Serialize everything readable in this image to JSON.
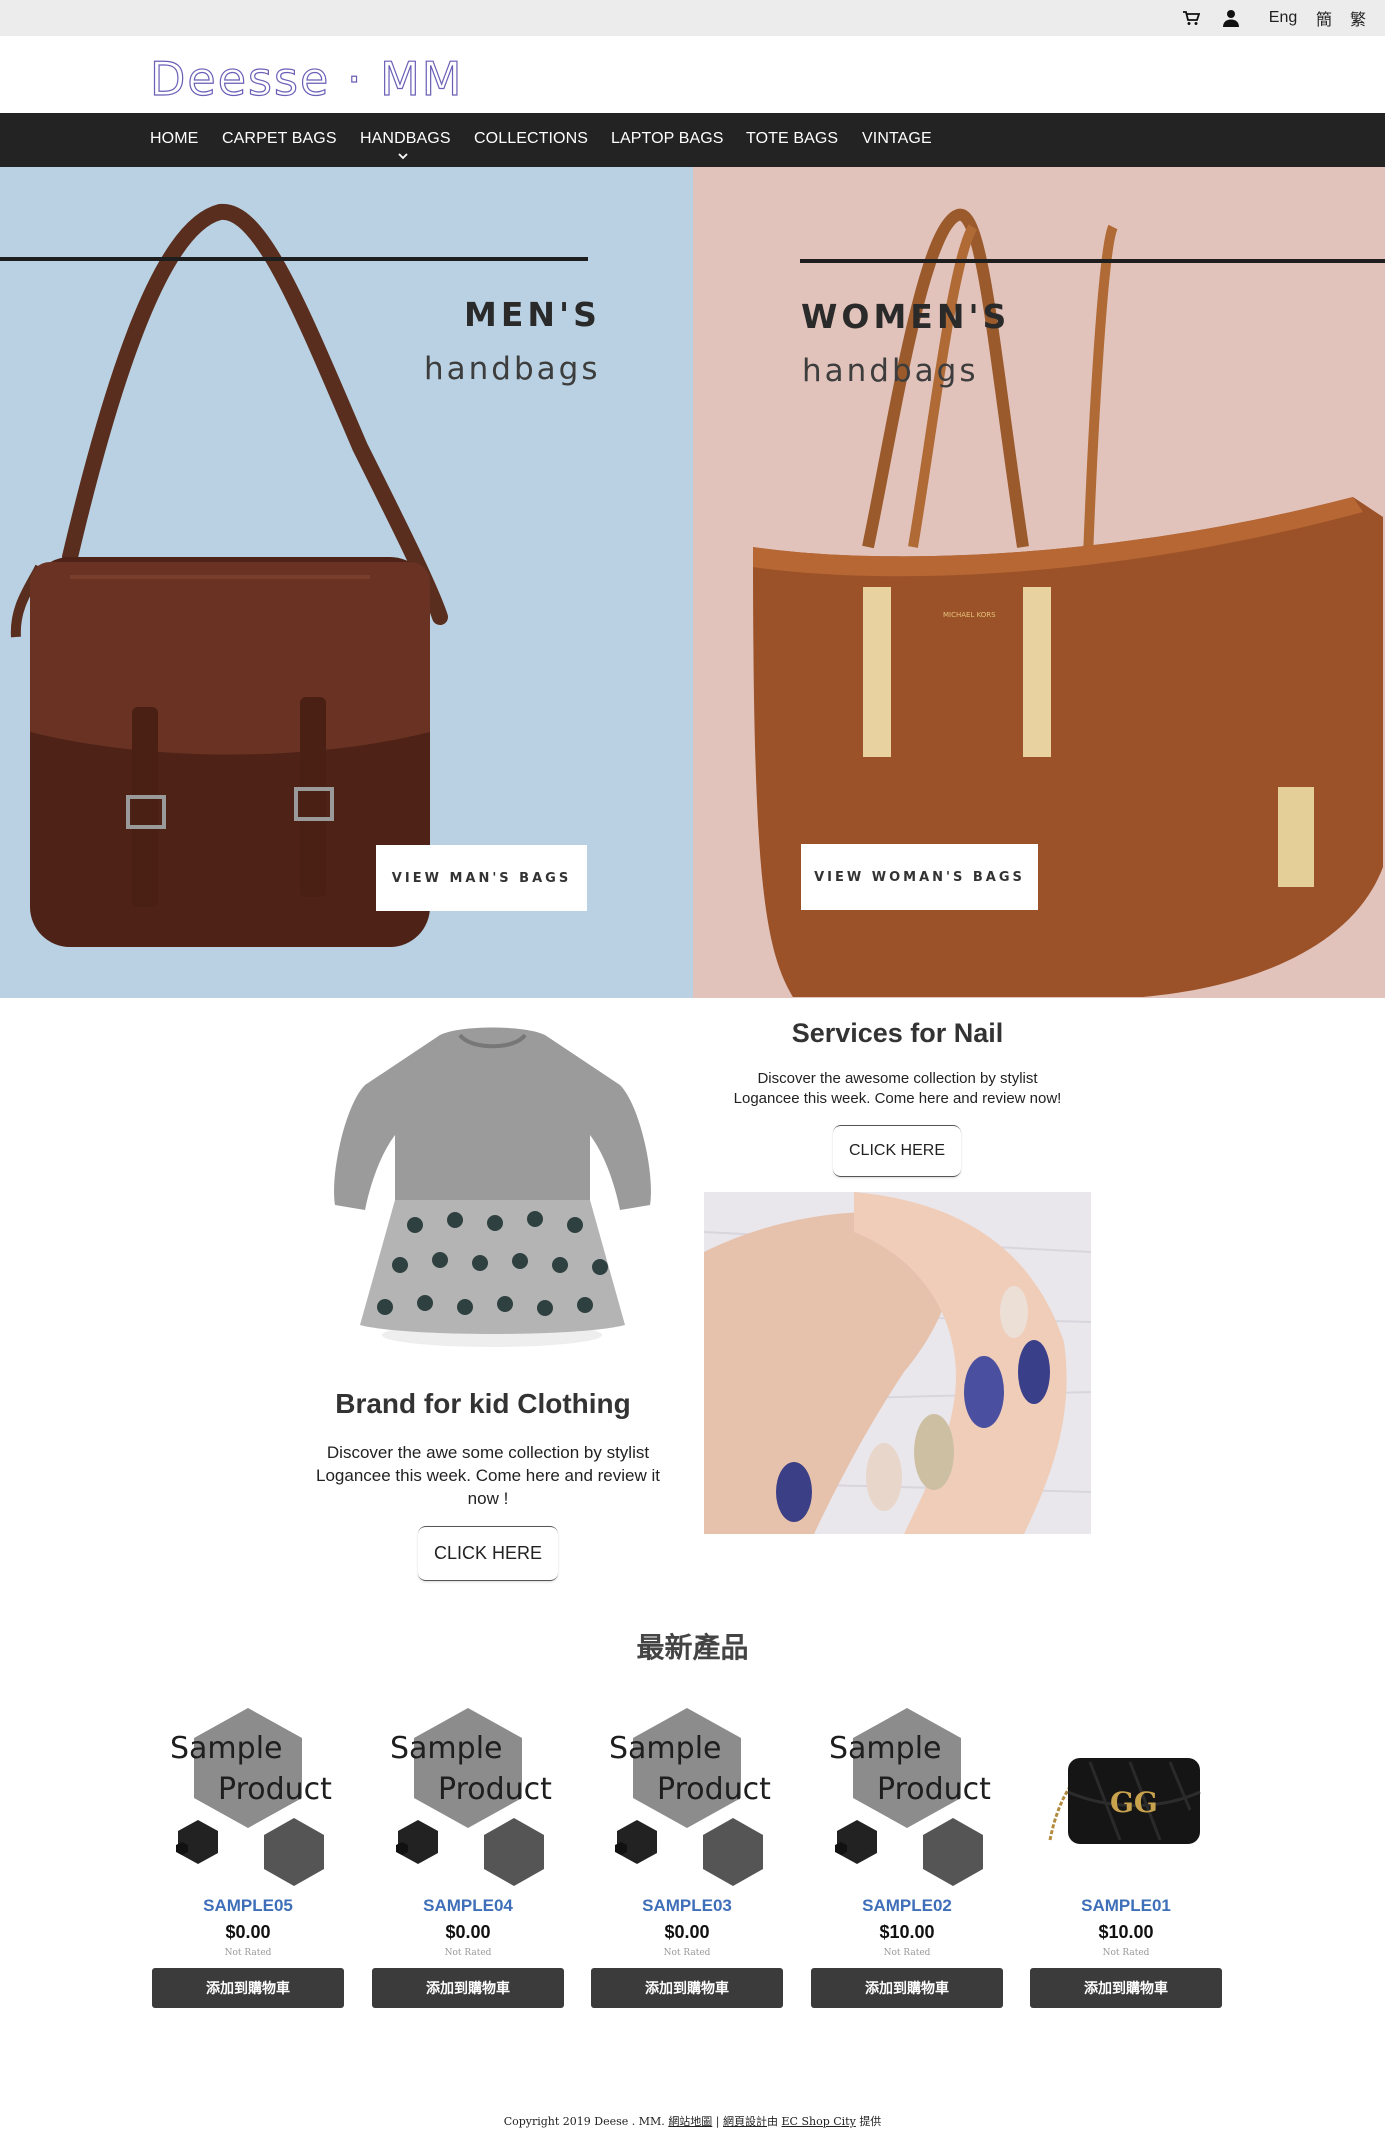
{
  "topbar": {
    "cart_icon": "cart-icon",
    "user_icon": "user-icon",
    "languages": [
      "Eng",
      "簡",
      "繁"
    ]
  },
  "header": {
    "logo_text": "Deesse · MM"
  },
  "nav": {
    "items": [
      "HOME",
      "CARPET BAGS",
      "HANDBAGS",
      "COLLECTIONS",
      "LAPTOP BAGS",
      "TOTE BAGS",
      "VINTAGE"
    ],
    "dropdown_icon": "chevron-down-icon"
  },
  "hero": {
    "men": {
      "title": "MEN'S",
      "subtitle": "handbags",
      "cta": "VIEW MAN'S BAGS",
      "bg_color": "#b9d1e2"
    },
    "women": {
      "title": "WOMEN'S",
      "subtitle": "handbags",
      "cta": "VIEW WOMAN'S BAGS",
      "bg_color": "#e2c3bb"
    }
  },
  "promos": {
    "nail": {
      "title": "Services for Nail",
      "desc": "Discover the awesome collection by stylist Logancee this week. Come here and review now!",
      "cta": "CLICK HERE"
    },
    "kids": {
      "title": "Brand for kid Clothing",
      "desc": "Discover the awe some collection by stylist Logancee this week. Come here and review it now !",
      "cta": "CLICK HERE"
    }
  },
  "products": {
    "heading": "最新產品",
    "placeholder_text": [
      "Sample",
      "Product"
    ],
    "items": [
      {
        "name": "SAMPLE05",
        "price": "$0.00",
        "rating": "Not Rated",
        "button": "添加到購物車"
      },
      {
        "name": "SAMPLE04",
        "price": "$0.00",
        "rating": "Not Rated",
        "button": "添加到購物車"
      },
      {
        "name": "SAMPLE03",
        "price": "$0.00",
        "rating": "Not Rated",
        "button": "添加到購物車"
      },
      {
        "name": "SAMPLE02",
        "price": "$10.00",
        "rating": "Not Rated",
        "button": "添加到購物車"
      },
      {
        "name": "SAMPLE01",
        "price": "$10.00",
        "rating": "Not Rated",
        "button": "添加到購物車"
      }
    ]
  },
  "footer": {
    "copyright": "Copyright 2019 Deese . MM.",
    "sitemap": "網站地圖",
    "sep": " | ",
    "design": "網頁設計",
    "by": "由",
    "provider": "EC Shop City",
    "provided": "提供"
  },
  "colors": {
    "accent_link": "#3e6fb8",
    "nav_bg": "#232323",
    "button_dark": "#3b3b3b"
  }
}
